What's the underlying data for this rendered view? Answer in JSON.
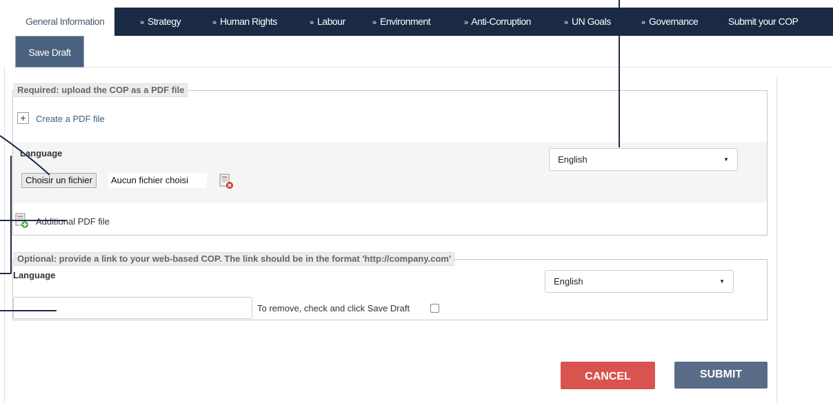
{
  "nav": {
    "tabs": [
      {
        "label": "General Information",
        "active": true
      },
      {
        "label": "Strategy",
        "prefix": "»"
      },
      {
        "label": "Human Rights",
        "prefix": "»"
      },
      {
        "label": "Labour",
        "prefix": "»"
      },
      {
        "label": "Environment",
        "prefix": "»"
      },
      {
        "label": "Anti-Corruption",
        "prefix": "»"
      },
      {
        "label": "UN Goals",
        "prefix": "»"
      },
      {
        "label": "Governance",
        "prefix": "»"
      },
      {
        "label": "Submit your COP"
      }
    ],
    "save_draft_label": "Save Draft"
  },
  "required_section": {
    "legend": "Required: upload the COP as a PDF file",
    "create_pdf_toggle": "+",
    "create_pdf_label": "Create a PDF file",
    "language_label": "Language",
    "language_value": "English",
    "file_button_label": "Choisir un fichier",
    "file_status": "Aucun fichier choisi",
    "remove_file_icon": "remove-document-icon",
    "additional_pdf_icon": "add-document-icon",
    "additional_pdf_label": "Additional PDF file"
  },
  "optional_section": {
    "legend": "Optional: provide a link to your web-based COP. The link should be in the format 'http://company.com'",
    "language_label": "Language",
    "language_value": "English",
    "link_value": "",
    "remove_label": "To remove, check and click Save Draft",
    "remove_checked": false
  },
  "actions": {
    "cancel_label": "CANCEL",
    "submit_label": "SUBMIT"
  },
  "colors": {
    "nav_bg": "#1a2a44",
    "save_draft_bg": "#4a6280",
    "cancel_bg": "#d9534f",
    "submit_bg": "#5a6b87",
    "link": "#3a5d7a",
    "callout": "#1a2a44"
  }
}
